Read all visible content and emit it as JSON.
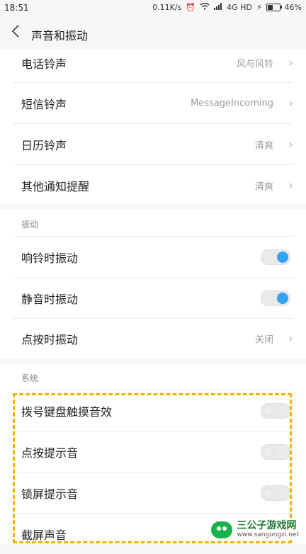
{
  "status": {
    "time": "18:51",
    "net_speed": "0.11K/s",
    "network": "4G HD",
    "battery": "46%"
  },
  "header": {
    "title": "声音和振动"
  },
  "ringtones": [
    {
      "label": "电话铃声",
      "value": "风与风铃"
    },
    {
      "label": "短信铃声",
      "value": "MessageIncoming"
    },
    {
      "label": "日历铃声",
      "value": "清爽"
    },
    {
      "label": "其他通知提醒",
      "value": "清爽"
    }
  ],
  "vibration": {
    "category": "振动",
    "items": [
      {
        "label": "响铃时振动",
        "state": "on"
      },
      {
        "label": "静音时振动",
        "state": "on"
      },
      {
        "label": "点按时振动",
        "value": "关闭"
      }
    ]
  },
  "system": {
    "category": "系统",
    "items": [
      {
        "label": "拨号键盘触摸音效",
        "state": "off"
      },
      {
        "label": "点按提示音",
        "state": "off"
      },
      {
        "label": "锁屏提示音",
        "state": "off"
      },
      {
        "label": "截屏声音"
      }
    ]
  },
  "watermark": {
    "title": "三公子游戏网",
    "url": "www.sangongzi.net"
  },
  "colors": {
    "toggle_on": "#34a4f2",
    "highlight": "#f0b400",
    "brand": "#19b24b"
  },
  "icons": {
    "back": "back-chevron-icon",
    "chevron": "chevron-right-icon"
  }
}
